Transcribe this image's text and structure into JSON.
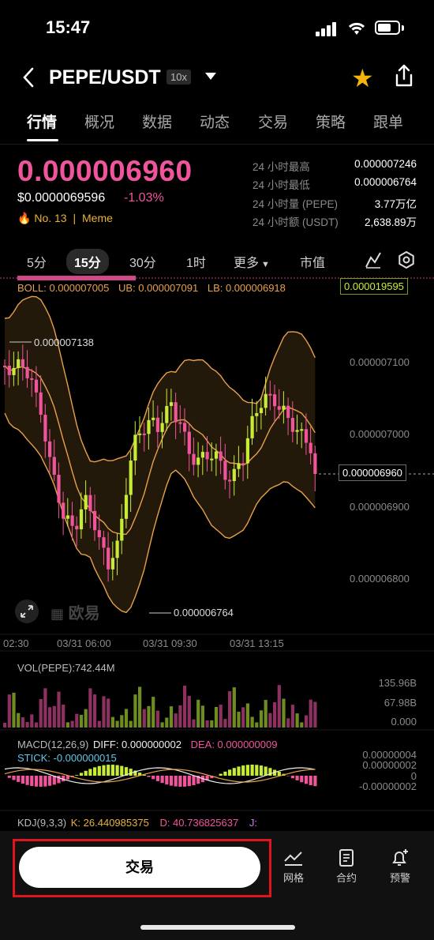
{
  "status": {
    "time": "15:47"
  },
  "header": {
    "pair": "PEPE/USDT",
    "leverage": "10x"
  },
  "tabs": [
    "行情",
    "概况",
    "数据",
    "动态",
    "交易",
    "策略",
    "跟单"
  ],
  "price": {
    "last": "0.000006960",
    "usd": "$0.0000069596",
    "change": "-1.03%",
    "rank": "No. 13",
    "tag": "Meme"
  },
  "stats": [
    {
      "label": "24 小时最高",
      "value": "0.000007246"
    },
    {
      "label": "24 小时最低",
      "value": "0.000006764"
    },
    {
      "label": "24 小时量 (PEPE)",
      "value": "3.77万亿"
    },
    {
      "label": "24 小时额 (USDT)",
      "value": "2,638.89万"
    }
  ],
  "intervals": [
    "5分",
    "15分",
    "30分",
    "1时",
    "更多",
    "市值"
  ],
  "chart": {
    "boll": "BOLL: 0.000007005",
    "ub": "UB: 0.000007091",
    "lb": "LB: 0.000006918",
    "top_box": "0.000019595",
    "y_ticks": [
      "0.000007100",
      "0.000007000",
      "0.000006900",
      "0.000006800"
    ],
    "last_box": "0.000006960",
    "hi_label": "0.000007138",
    "lo_label": "0.000006764",
    "x_ticks": [
      "02:30",
      "03/31 06:00",
      "03/31 09:30",
      "03/31 13:15"
    ],
    "watermark": "欧易",
    "vol_label": "VOL(PEPE):742.44M",
    "vol_ticks": [
      "135.96B",
      "67.98B",
      "0.000"
    ],
    "macd_label": "MACD(12,26,9)",
    "macd_diff": "DIFF: 0.000000002",
    "macd_dea": "DEA: 0.000000009",
    "macd_stick": "STICK: -0.000000015",
    "macd_ticks": [
      "0.00000004",
      "0.00000002",
      "0",
      "-0.00000002"
    ],
    "kdj_label": "KDJ(9,3,3)",
    "kdj_k": "K: 26.440985375",
    "kdj_d": "D: 40.736825637",
    "kdj_j": "J:",
    "colors": {
      "up": "#c8ec36",
      "down": "#f0559c",
      "ub": "#e8a04a",
      "mid": "#e8a04a"
    }
  },
  "bottom": {
    "trade": "交易",
    "grid": "网格",
    "contract": "合约",
    "alert": "预警"
  }
}
